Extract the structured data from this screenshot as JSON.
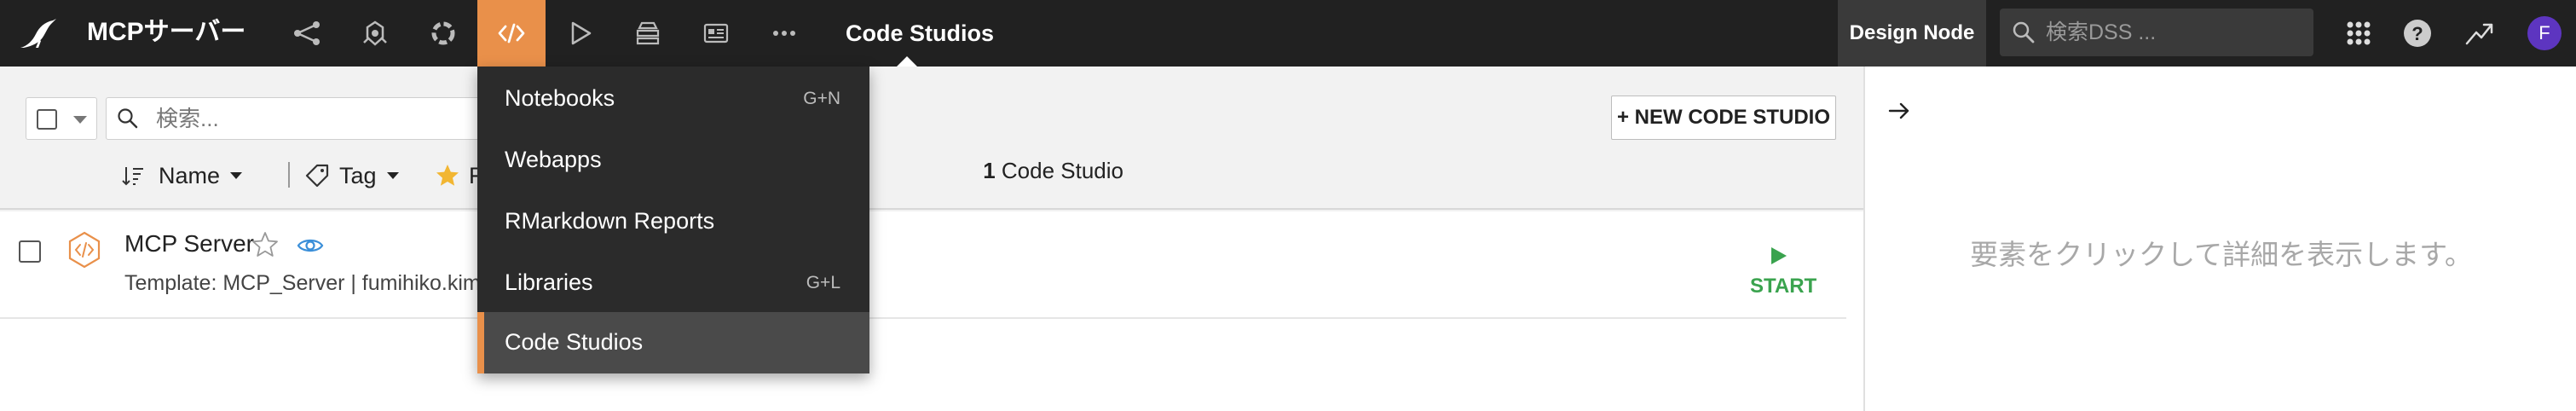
{
  "header": {
    "project_name": "MCPサーバー",
    "section_title": "Code Studios",
    "design_node": "Design Node",
    "search_placeholder": "検索DSS ...",
    "avatar_initial": "F",
    "accent_color": "#e9904a"
  },
  "dropdown": {
    "items": [
      {
        "label": "Notebooks",
        "shortcut": "G+N"
      },
      {
        "label": "Webapps",
        "shortcut": ""
      },
      {
        "label": "RMarkdown Reports",
        "shortcut": ""
      },
      {
        "label": "Libraries",
        "shortcut": "G+L"
      },
      {
        "label": "Code Studios",
        "shortcut": ""
      }
    ],
    "active_item": "Code Studios"
  },
  "toolbar": {
    "search_placeholder": "検索...",
    "sort_label": "Name",
    "tag_label": "Tag",
    "favorites_label": "F",
    "new_button": "+ NEW CODE STUDIO",
    "count_number": "1",
    "count_label": "Code Studio"
  },
  "list": {
    "rows": [
      {
        "title": "MCP Server",
        "subtitle": "Template: MCP_Server | fumihiko.kim",
        "action": "START"
      }
    ]
  },
  "right_panel": {
    "empty_message": "要素をクリックして詳細を表示します。"
  }
}
